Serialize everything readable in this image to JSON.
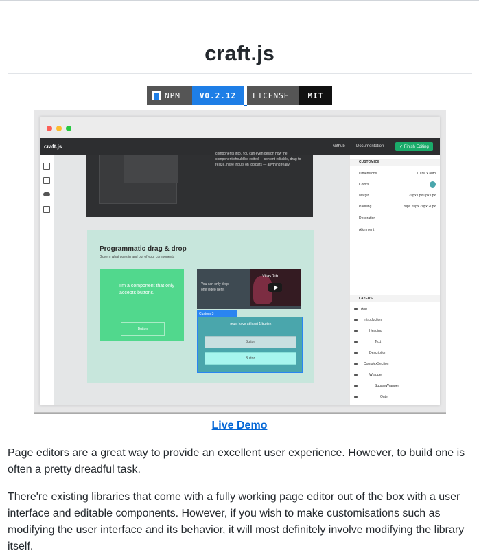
{
  "title": "craft.js",
  "badges": {
    "npm_label": "NPM",
    "npm_value": "V0.2.12",
    "license_label": "LICENSE",
    "license_value": "MIT"
  },
  "screenshot": {
    "app_name": "craft.js",
    "nav_links": [
      "Github",
      "Documentation"
    ],
    "finish_button": "✓ Finish Editing",
    "dark_text": "components into. You can even design how the component should be edited — content editable, drag to resize, have inputs on toolbars — anything really.",
    "section_title": "Programmatic drag & drop",
    "section_subtitle": "Govern what goes in and out of your components",
    "green_card_text": "I'm a component that only accepts buttons.",
    "green_card_button": "Button",
    "video_card_text": "You can only drop one video here.",
    "video_title": "Vitas 7th...",
    "selection_tag": "Custom 3",
    "teal_card_text": "I must have at least 1 button",
    "teal_buttons": [
      "Button",
      "Button"
    ],
    "customize_header": "CUSTOMIZE",
    "props": [
      {
        "name": "Dimensions",
        "value": "100% x auto"
      },
      {
        "name": "Colors",
        "value": ""
      },
      {
        "name": "Margin",
        "value": "20px 0px 0px 0px"
      },
      {
        "name": "Padding",
        "value": "20px 20px 20px 20px"
      },
      {
        "name": "Decoration",
        "value": ""
      },
      {
        "name": "Alignment",
        "value": ""
      }
    ],
    "layers_header": "LAYERS",
    "layers": [
      "App",
      "Introduction",
      "Heading",
      "Text",
      "Description",
      "ComplexSection",
      "Wrapper",
      "SquareWrapper",
      "Outer"
    ],
    "colors": {
      "accent": "#1aab6a",
      "selection": "#2a85f1",
      "green_card": "#51d88d",
      "teal_card": "#4aa6ac"
    }
  },
  "live_demo": "Live Demo",
  "paragraphs": [
    "Page editors are a great way to provide an excellent user experience. However, to build one is often a pretty dreadful task.",
    "There're existing libraries that come with a fully working page editor out of the box with a user interface and editable components. However, if you wish to make customisations such as modifying the user interface and its behavior, it will most definitely involve modifying the library itself."
  ]
}
